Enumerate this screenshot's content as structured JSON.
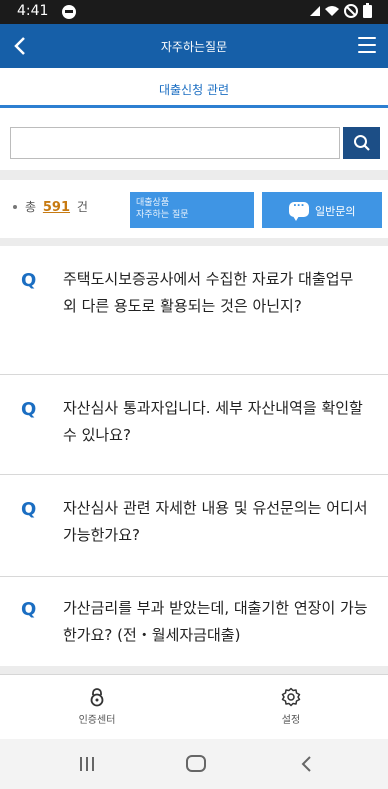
{
  "status_bar": {
    "time": "4:41",
    "icons": "✈ ≈ ⊘ ▮"
  },
  "header": {
    "title": "자주하는질문",
    "back_icon": "back-arrow-icon",
    "menu_icon": "hamburger-menu-icon",
    "color": "#165fa8"
  },
  "subtab": {
    "label": "대출신청 관련"
  },
  "search": {
    "value": "",
    "placeholder": "",
    "button_icon": "search-icon",
    "button_color": "#1c4e86"
  },
  "summary": {
    "prefix": "총",
    "count": "591",
    "suffix": "건",
    "faq_button_line1": "대출상품",
    "faq_button_line2": "자주하는 질문",
    "inquiry_button_label": "일반문의",
    "accent": "#3f95e4"
  },
  "faq": {
    "marker": "Q",
    "items": [
      {
        "question": "주택도시보증공사에서 수집한 자료가 대출업무 외 다른 용도로 활용되는 것은 아닌지?"
      },
      {
        "question": "자산심사 통과자입니다. 세부 자산내역을 확인할 수 있나요?"
      },
      {
        "question": "자산심사 관련 자세한 내용 및 유선문의는 어디서 가능한가요?"
      },
      {
        "question": "가산금리를 부과 받았는데, 대출기한 연장이 가능한가요? (전・월세자금대출)"
      }
    ]
  },
  "bottom_nav": {
    "items": [
      {
        "label": "인증센터",
        "icon": "lock-icon"
      },
      {
        "label": "설정",
        "icon": "gear-icon"
      }
    ]
  }
}
